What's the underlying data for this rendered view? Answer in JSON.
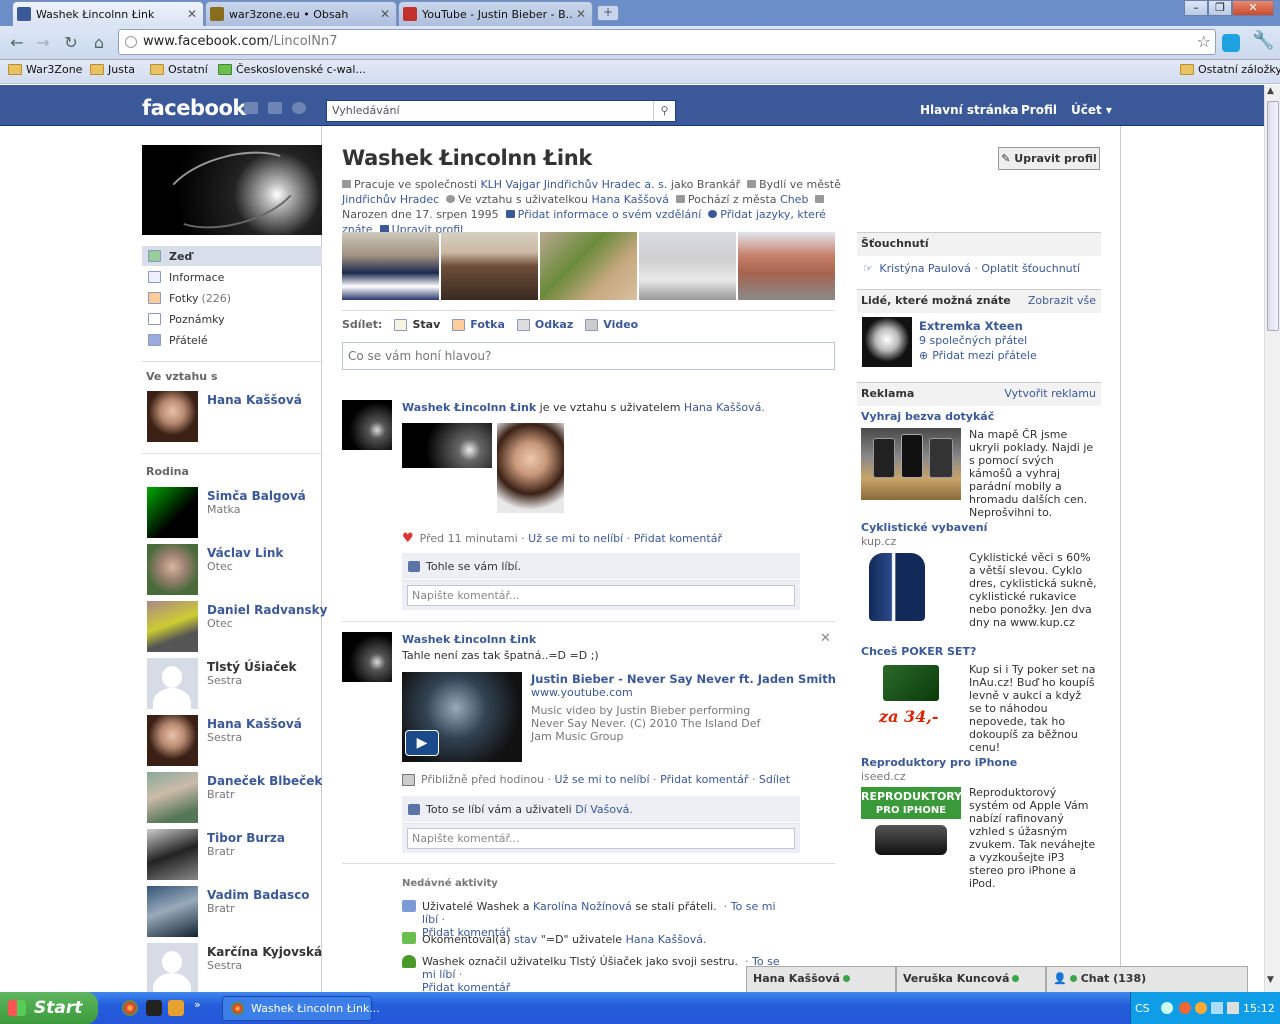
{
  "browser": {
    "tabs": [
      {
        "label": "Washek Łincolnn Łink",
        "color": "#3b5998"
      },
      {
        "label": "war3zone.eu • Obsah",
        "color": "#8a6d1c"
      },
      {
        "label": "YouTube - Justin Bieber - B...",
        "color": "#c4302b"
      }
    ],
    "url_host": "www.facebook.com",
    "url_path": "/LincolNn7",
    "bookmarks": [
      "War3Zone",
      "Justa",
      "Ostatní",
      "Československé c-wal...",
      "Ostatní záložky"
    ]
  },
  "fb": {
    "logo": "facebook",
    "search_placeholder": "Vyhledávání",
    "nav": [
      "Hlavní stránka",
      "Profil",
      "Účet ▾"
    ]
  },
  "left": {
    "nav": [
      {
        "label": "Zeď",
        "count": ""
      },
      {
        "label": "Informace",
        "count": ""
      },
      {
        "label": "Fotky",
        "count": "(226)"
      },
      {
        "label": "Poznámky",
        "count": ""
      },
      {
        "label": "Přátelé",
        "count": ""
      }
    ],
    "relationship_title": "Ve vztahu s",
    "relationship_person": "Hana Kaššová",
    "family_title": "Rodina",
    "family": [
      {
        "name": "Simča Balgová",
        "role": "Matka"
      },
      {
        "name": "Václav Link",
        "role": "Otec"
      },
      {
        "name": "Daniel Radvansky",
        "role": "Otec"
      },
      {
        "name": "Tlstý Úšiaček",
        "role": "Sestra"
      },
      {
        "name": "Hana Kaššová",
        "role": "Sestra"
      },
      {
        "name": "Daneček Blbeček",
        "role": "Bratr"
      },
      {
        "name": "Tibor Burza",
        "role": "Bratr"
      },
      {
        "name": "Vadim Badasco",
        "role": "Bratr"
      },
      {
        "name": "Karčína Kyjovská",
        "role": "Sestra"
      }
    ]
  },
  "profile": {
    "name": "Washek Łincolnn Łink",
    "edit_button": "✎ Upravit profil",
    "info": {
      "work_prefix": "Pracuje ve společnosti",
      "work": "KLH Vajgar Jindřichův Hradec a. s.",
      "work_suffix": "jako Brankář",
      "lives_prefix": "Bydlí ve městě",
      "lives": "Jindřichův Hradec",
      "rel_prefix": "Ve vztahu s uživatelkou",
      "rel": "Hana Kaššová",
      "from_prefix": "Pochází z města",
      "from": "Cheb",
      "born": "Narozen dne 17. srpen 1995",
      "add_edu": "Přidat informace o svém vzdělání",
      "add_lang": "Přidat jazyky, které znáte",
      "edit": "Upravit profil"
    },
    "share_label": "Sdílet:",
    "share_items": [
      "Stav",
      "Fotka",
      "Odkaz",
      "Video"
    ],
    "composer_placeholder": "Co se vám honí hlavou?"
  },
  "stories": [
    {
      "author": "Washek Łincolnn Łink",
      "text": "je ve vztahu s uživatelem",
      "target": "Hana Kaššová.",
      "time": "Před 11 minutami",
      "actions": [
        "Už se mi to nelíbí",
        "Přidat komentář"
      ],
      "likes": "Tohle se vám líbí.",
      "comment_placeholder": "Napište komentář..."
    },
    {
      "author": "Washek Łincolnn Łink",
      "text": "Tahle není zas tak špatná..=D =D ;)",
      "video_title": "Justin Bieber - Never Say Never ft. Jaden Smith",
      "video_domain": "www.youtube.com",
      "video_desc": "Music video by Justin Bieber performing Never Say Never. (C) 2010 The Island Def Jam Music Group",
      "time": "Přibližně před hodinou",
      "actions": [
        "Už se mi to nelíbí",
        "Přidat komentář",
        "Sdílet"
      ],
      "likes_prefix": "Toto se líbí vám a uživateli",
      "likes_person": "Dí Vašová.",
      "comment_placeholder": "Napište komentář..."
    }
  ],
  "recent": {
    "title": "Nedávné aktivity",
    "items": [
      {
        "a": "Uživatelé Washek a",
        "b": "Karolína Nožínová",
        "c": "se stali přáteli.",
        "l1": "To se mi líbí",
        "l2": "Přidat komentář"
      },
      {
        "a": "Okomentoval(a)",
        "b": "stav",
        "c": "\"=D\" uživatele",
        "d": "Hana Kaššová."
      },
      {
        "a": "Washek označil uživatelku Tlstý Úšiaček jako svoji sestru.",
        "l1": "To se mi líbí",
        "l2": "Přidat komentář"
      }
    ]
  },
  "right": {
    "poke_title": "Šťouchnutí",
    "poke_name": "Kristýna Paulová",
    "poke_action": "Oplatit šťouchnutí",
    "pymk_title": "Lidé, které možná znáte",
    "pymk_all": "Zobrazit vše",
    "pymk_name": "Extremka Xteen",
    "pymk_mutual": "9 společných přátel",
    "pymk_add": "Přidat mezi přátele",
    "ads_title": "Reklama",
    "ads_create": "Vytvořit reklamu",
    "ads": [
      {
        "title": "Vyhraj bezva dotykáč",
        "domain": "",
        "text": "Na mapě ČR jsme ukryli poklady. Najdi je s pomocí svých kámošů a vyhraj parádní mobily a hromadu dalších cen. Neprošvihni to."
      },
      {
        "title": "Cyklistické vybavení",
        "domain": "kup.cz",
        "text": "Cyklistické věci s 60% a větší slevou. Cyklo dres, cyklistická sukně, cyklistické rukavice nebo ponožky. Jen dva dny na www.kup.cz"
      },
      {
        "title": "Chceš POKER SET?",
        "domain": "",
        "text": "Kup si i Ty poker set na InAu.cz! Buď ho koupíš levně v aukci a když se to náhodou nepovede, tak ho dokoupíš za běžnou cenu!",
        "img_text": "za 34,-"
      },
      {
        "title": "Reproduktory pro iPhone",
        "domain": "iseed.cz",
        "text": "Reproduktorový systém od Apple Vám nabízí rafinovaný vzhled s úžasným zvukem. Tak neváhejte a vyzkoušejte iP3 stereo pro iPhone a iPod.",
        "img_text1": "REPRODUKTORY",
        "img_text2": "PRO IPHONE"
      }
    ]
  },
  "chat": {
    "friends": [
      "Hana Kaššová",
      "Veruška Kuncová"
    ],
    "label": "Chat (138)"
  },
  "taskbar": {
    "start": "Start",
    "item": "Washek Łincolnn Łink...",
    "lang": "CS",
    "time": "15:12"
  }
}
